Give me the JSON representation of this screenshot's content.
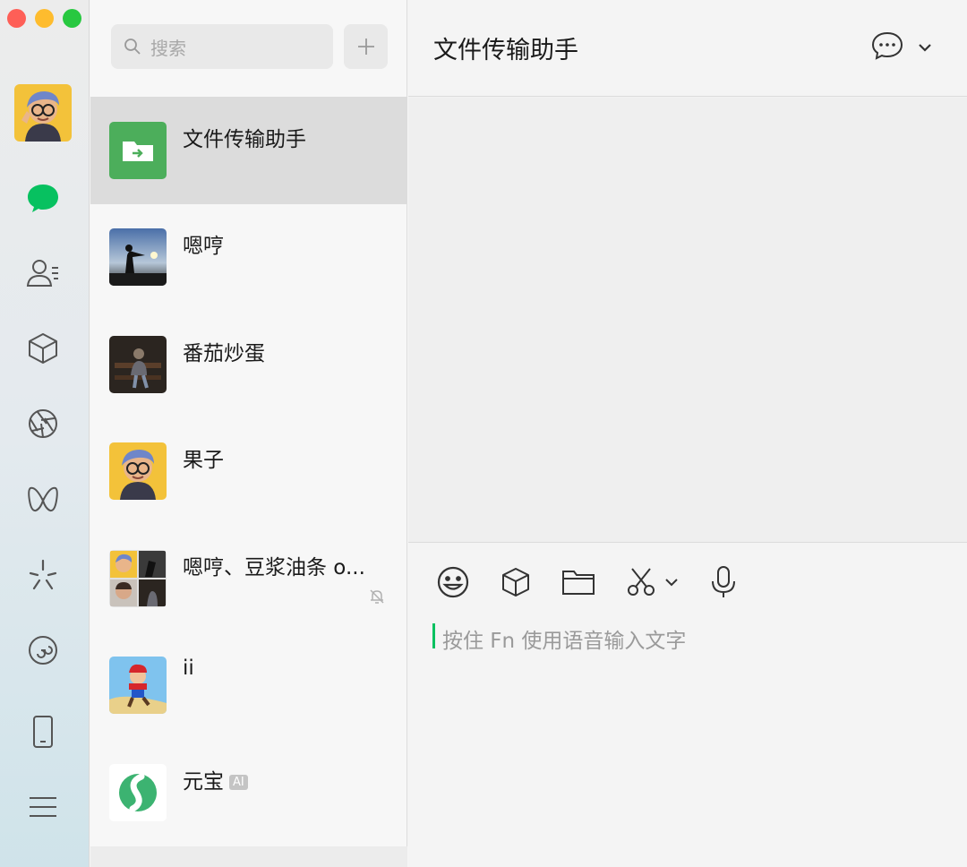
{
  "window": {
    "controls": [
      "close",
      "minimize",
      "zoom"
    ]
  },
  "rail": {
    "items": [
      {
        "icon": "chat-bubble-icon",
        "active": true
      },
      {
        "icon": "contacts-icon"
      },
      {
        "icon": "favorites-box-icon"
      },
      {
        "icon": "moments-aperture-icon"
      },
      {
        "icon": "channels-icon"
      },
      {
        "icon": "search-sparkle-icon"
      },
      {
        "icon": "mini-programs-icon"
      },
      {
        "icon": "phone-device-icon"
      },
      {
        "icon": "menu-icon"
      }
    ]
  },
  "search": {
    "placeholder": "搜索"
  },
  "conversations": [
    {
      "name": "文件传输助手",
      "active": true
    },
    {
      "name": "嗯哼"
    },
    {
      "name": "番茄炒蛋"
    },
    {
      "name": "果子"
    },
    {
      "name": "嗯哼、豆浆油条 o...",
      "muted": true
    },
    {
      "name": "ii"
    },
    {
      "name": "元宝",
      "badge": "AI"
    }
  ],
  "chat": {
    "title": "文件传输助手",
    "input_hint": "按住 Fn  使用语音输入文字"
  },
  "colors": {
    "accent": "#07c160",
    "selected_row": "#dcdcdc"
  }
}
